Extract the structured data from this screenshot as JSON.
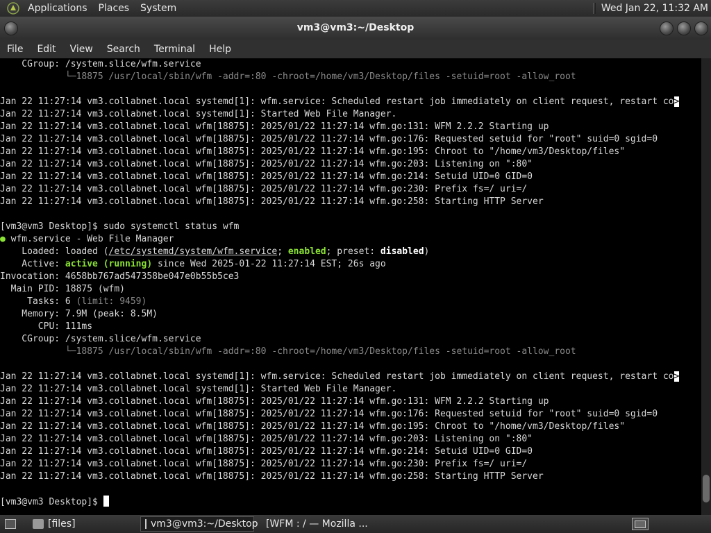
{
  "top_panel": {
    "menus": [
      "Applications",
      "Places",
      "System"
    ],
    "clock": "Wed Jan 22, 11:32 AM"
  },
  "window": {
    "title": "vm3@vm3:~/Desktop",
    "menu": [
      "File",
      "Edit",
      "View",
      "Search",
      "Terminal",
      "Help"
    ]
  },
  "terminal": {
    "top_cgroup_label": "    CGroup: ",
    "top_cgroup_value": "/system.slice/wfm.service",
    "process_line": "            └─18875 /usr/local/sbin/wfm -addr=:80 -chroot=/home/vm3/Desktop/files -setuid=root -allow_root",
    "log_block": [
      "Jan 22 11:27:14 vm3.collabnet.local systemd[1]: wfm.service: Scheduled restart job immediately on client request, restart co",
      "Jan 22 11:27:14 vm3.collabnet.local systemd[1]: Started Web File Manager.",
      "Jan 22 11:27:14 vm3.collabnet.local wfm[18875]: 2025/01/22 11:27:14 wfm.go:131: WFM 2.2.2 Starting up",
      "Jan 22 11:27:14 vm3.collabnet.local wfm[18875]: 2025/01/22 11:27:14 wfm.go:176: Requested setuid for \"root\" suid=0 sgid=0",
      "Jan 22 11:27:14 vm3.collabnet.local wfm[18875]: 2025/01/22 11:27:14 wfm.go:195: Chroot to \"/home/vm3/Desktop/files\"",
      "Jan 22 11:27:14 vm3.collabnet.local wfm[18875]: 2025/01/22 11:27:14 wfm.go:203: Listening on \":80\"",
      "Jan 22 11:27:14 vm3.collabnet.local wfm[18875]: 2025/01/22 11:27:14 wfm.go:214: Setuid UID=0 GID=0",
      "Jan 22 11:27:14 vm3.collabnet.local wfm[18875]: 2025/01/22 11:27:14 wfm.go:230: Prefix fs=/ uri=/",
      "Jan 22 11:27:14 vm3.collabnet.local wfm[18875]: 2025/01/22 11:27:14 wfm.go:258: Starting HTTP Server"
    ],
    "truncation_marker": ">",
    "prompt": "[vm3@vm3 Desktop]$ ",
    "command": "sudo systemctl status wfm",
    "status": {
      "bullet": "●",
      "unit_line": " wfm.service - Web File Manager",
      "loaded_label": "    Loaded: loaded (",
      "loaded_path": "/etc/systemd/system/wfm.service",
      "loaded_sep1": "; ",
      "loaded_enabled": "enabled",
      "loaded_sep2": "; preset: ",
      "loaded_preset": "disabled",
      "loaded_end": ")",
      "active_label": "    Active: ",
      "active_state": "active (running)",
      "active_rest": " since Wed 2025-01-22 11:27:14 EST; 26s ago",
      "invocation": "Invocation: 4658bb767ad547358be047e0b55b5ce3",
      "main_pid": "  Main PID: 18875 (wfm)",
      "tasks_label": "     Tasks: 6 ",
      "tasks_limit": "(limit: 9459)",
      "memory": "    Memory: 7.9M (peak: 8.5M)",
      "cpu": "       CPU: 111ms",
      "cgroup_label": "    CGroup: ",
      "cgroup_value": "/system.slice/wfm.service"
    }
  },
  "taskbar": {
    "tasks": [
      "[files]",
      "vm3@vm3:~/Desktop",
      "[WFM : / — Mozilla ..."
    ]
  },
  "colors": {
    "terminal_bg": "#000000",
    "terminal_fg": "#d8d8d8",
    "status_green": "#8ae234",
    "panel_bg": "#2e2e2e"
  }
}
